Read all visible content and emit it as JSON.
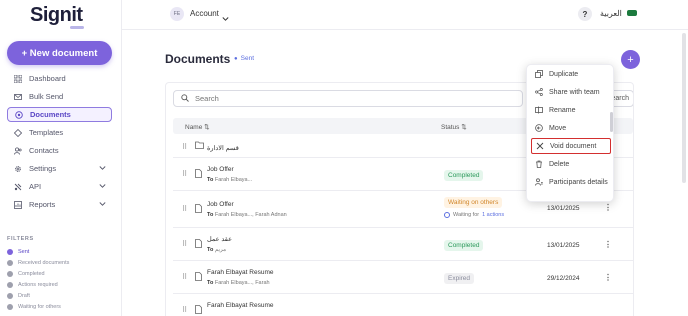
{
  "brand": {
    "logo": "Signit"
  },
  "sidebar": {
    "new_document": "+ New document",
    "items": [
      {
        "label": "Dashboard",
        "icon": "grid-icon",
        "active": false
      },
      {
        "label": "Bulk Send",
        "icon": "mail-icon",
        "active": false
      },
      {
        "label": "Documents",
        "icon": "documents-icon",
        "active": true
      },
      {
        "label": "Templates",
        "icon": "template-icon",
        "active": false
      },
      {
        "label": "Contacts",
        "icon": "contacts-icon",
        "active": false
      },
      {
        "label": "Settings",
        "icon": "gear-icon",
        "active": false,
        "expandable": true
      },
      {
        "label": "API",
        "icon": "api-icon",
        "active": false,
        "expandable": true
      },
      {
        "label": "Reports",
        "icon": "reports-icon",
        "active": false,
        "expandable": true
      }
    ],
    "filters_title": "FILTERS",
    "filters": [
      {
        "label": "Sent",
        "active": true
      },
      {
        "label": "Received documents",
        "active": false
      },
      {
        "label": "Completed",
        "active": false
      },
      {
        "label": "Actions required",
        "active": false
      },
      {
        "label": "Draft",
        "active": false
      },
      {
        "label": "Waiting for others",
        "active": false
      }
    ]
  },
  "topbar": {
    "avatar_initials": "FE",
    "account_label": "Account",
    "help": "?",
    "language": "العربية"
  },
  "main": {
    "title": "Documents",
    "filter_tag": "Sent",
    "search_placeholder": "Search",
    "search_button": "Search",
    "columns": {
      "name": "Name",
      "status": "Status"
    },
    "rows": [
      {
        "type": "folder",
        "name": "قسم الادارة"
      },
      {
        "type": "doc",
        "name": "Job Offer",
        "to_prefix": "To",
        "to": "Farah Elbaya...",
        "status": "Completed",
        "status_kind": "completed",
        "date": ""
      },
      {
        "type": "doc",
        "name": "Job Offer",
        "to_prefix": "To",
        "to": "Farah Elbaya..., Farah Adnan",
        "status": "Waiting on others",
        "status_kind": "waiting",
        "waiting_for": "Waiting for",
        "actions": "1 actions",
        "date": "13/01/2025"
      },
      {
        "type": "doc",
        "name": "عقد عمل",
        "to_prefix": "To",
        "to": "مريم",
        "status": "Completed",
        "status_kind": "completed",
        "date": "13/01/2025"
      },
      {
        "type": "doc",
        "name": "Farah Elbayat Resume",
        "to_prefix": "To",
        "to": "Farah Elbaya..., Farah",
        "status": "Expired",
        "status_kind": "expired",
        "date": "29/12/2024"
      },
      {
        "type": "doc",
        "name": "Farah Elbayat Resume",
        "to_prefix": "",
        "to": "",
        "status": "",
        "status_kind": "",
        "date": ""
      }
    ]
  },
  "context_menu": {
    "items": [
      {
        "label": "Duplicate",
        "icon": "copy-icon",
        "highlight": false
      },
      {
        "label": "Share with team",
        "icon": "share-icon",
        "highlight": false
      },
      {
        "label": "Rename",
        "icon": "rename-icon",
        "highlight": false
      },
      {
        "label": "Move",
        "icon": "move-icon",
        "highlight": false
      },
      {
        "label": "Void document",
        "icon": "close-icon",
        "highlight": true
      },
      {
        "label": "Delete",
        "icon": "trash-icon",
        "highlight": false
      },
      {
        "label": "Participants details",
        "icon": "participants-icon",
        "highlight": false
      }
    ],
    "highlight_color": "#d32f2f"
  },
  "colors": {
    "accent": "#7d63dc",
    "completed": "#2c9a5b",
    "waiting": "#d1862a",
    "expired": "#8a8c9c"
  }
}
